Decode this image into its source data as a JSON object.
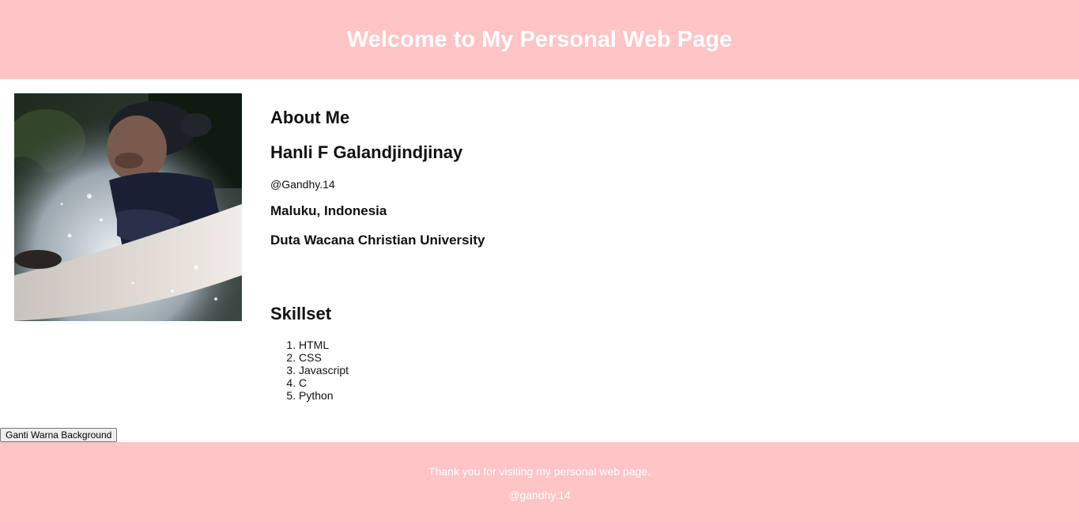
{
  "header": {
    "title": "Welcome to My Personal Web Page"
  },
  "profile": {
    "photo_alt": "profile photo",
    "about_heading": "About Me",
    "name": "Hanli F Galandjindjinay",
    "handle": "@Gandhy.14",
    "location": "Maluku, Indonesia",
    "university": "Duta Wacana Christian University"
  },
  "skills": {
    "heading": "Skillset",
    "items": [
      "HTML",
      "CSS",
      "Javascript",
      "C",
      "Python"
    ]
  },
  "button": {
    "label": "Ganti Warna Background"
  },
  "footer": {
    "message": "Thank you for visiting my personal web page.",
    "handle": "@gandhy.14"
  },
  "colors": {
    "accent": "#ffc4c5",
    "header_text": "#ffffff"
  }
}
